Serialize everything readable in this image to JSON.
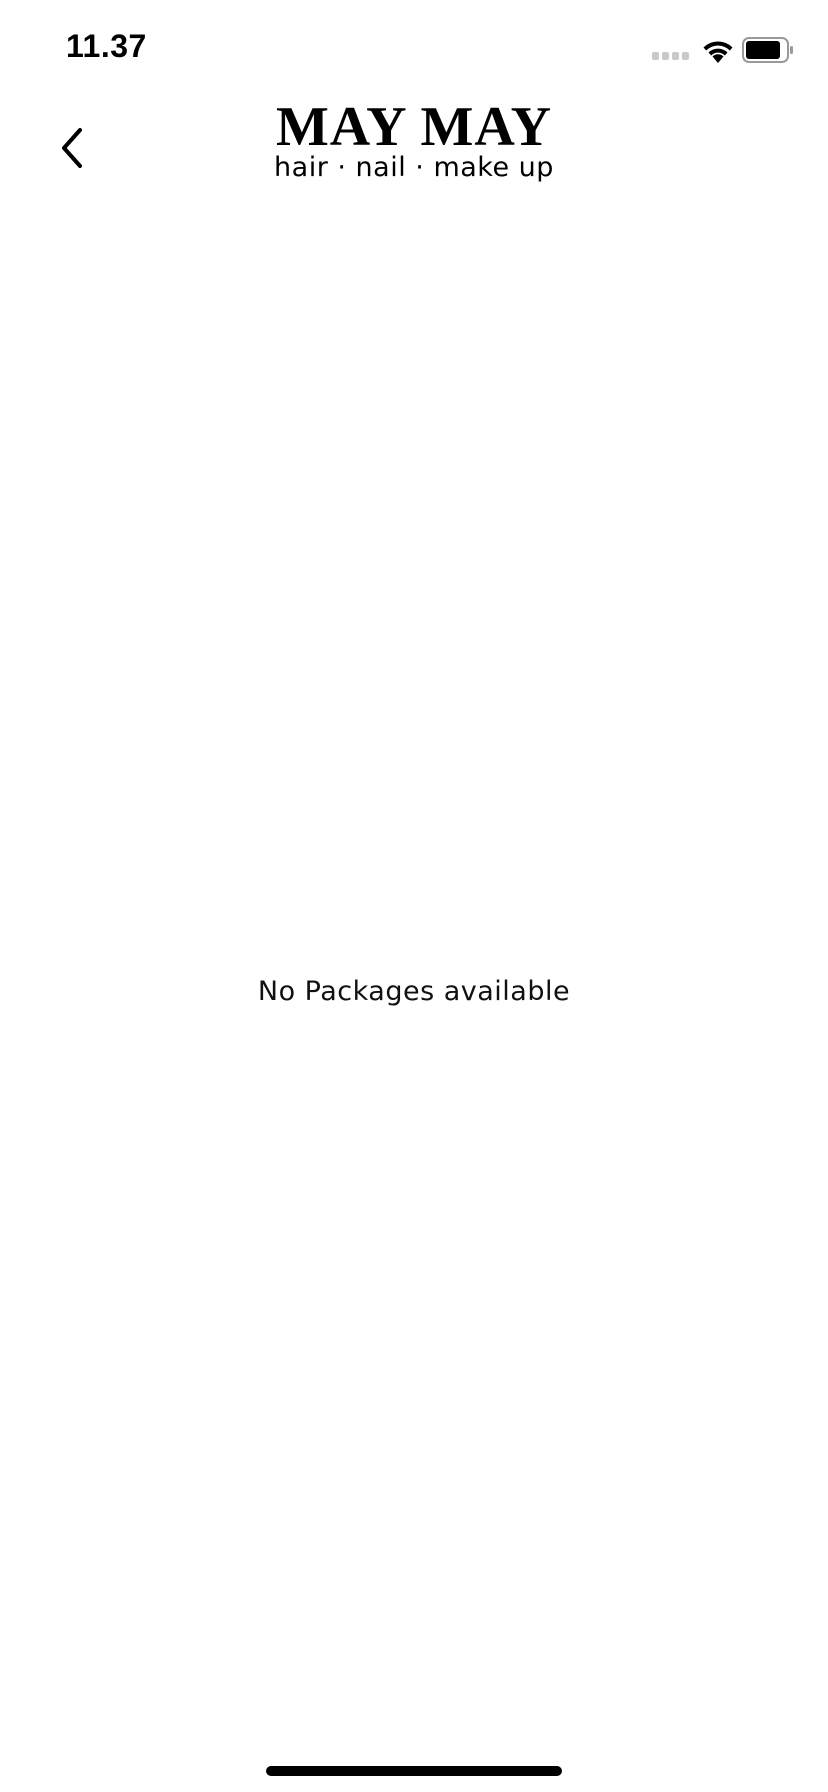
{
  "status_bar": {
    "time": "11.37",
    "signal_icon": "cellular-signal-icon",
    "wifi_icon": "wifi-icon",
    "battery_icon": "battery-icon"
  },
  "header": {
    "back_icon": "chevron-left-icon",
    "logo_title": "MAY MAY",
    "logo_tagline": "hair · nail · make up"
  },
  "content": {
    "empty_message": "No Packages available"
  },
  "colors": {
    "background": "#ffffff",
    "text": "#000000",
    "signal_inactive": "#c9c9c9"
  }
}
